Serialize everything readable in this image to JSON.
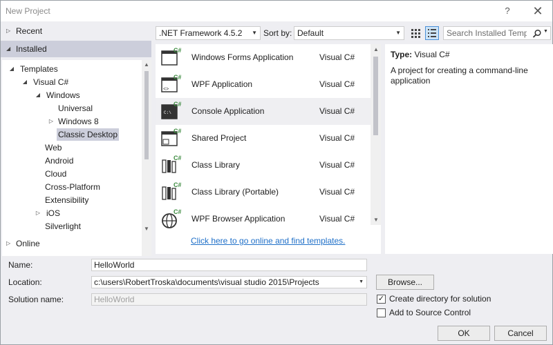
{
  "window": {
    "title": "New Project",
    "help_glyph": "?",
    "close_glyph": "✕"
  },
  "nav": {
    "recent": "Recent",
    "installed": "Installed",
    "online": "Online",
    "tree": [
      {
        "label": "Templates"
      },
      {
        "label": "Visual C#"
      },
      {
        "label": "Windows"
      },
      {
        "label": "Universal"
      },
      {
        "label": "Windows 8"
      },
      {
        "label": "Classic Desktop"
      },
      {
        "label": "Web"
      },
      {
        "label": "Android"
      },
      {
        "label": "Cloud"
      },
      {
        "label": "Cross-Platform"
      },
      {
        "label": "Extensibility"
      },
      {
        "label": "iOS"
      },
      {
        "label": "Silverlight"
      }
    ]
  },
  "toolbar": {
    "framework": ".NET Framework 4.5.2",
    "sort_by_label": "Sort by:",
    "sort_by_value": "Default",
    "search_placeholder": "Search Installed Templ"
  },
  "templates": [
    {
      "name": "Windows Forms Application",
      "lang": "Visual C#",
      "icon": "winforms-icon"
    },
    {
      "name": "WPF Application",
      "lang": "Visual C#",
      "icon": "wpf-icon"
    },
    {
      "name": "Console Application",
      "lang": "Visual C#",
      "icon": "console-icon"
    },
    {
      "name": "Shared Project",
      "lang": "Visual C#",
      "icon": "shared-project-icon"
    },
    {
      "name": "Class Library",
      "lang": "Visual C#",
      "icon": "class-library-icon"
    },
    {
      "name": "Class Library (Portable)",
      "lang": "Visual C#",
      "icon": "portable-library-icon"
    },
    {
      "name": "WPF Browser Application",
      "lang": "Visual C#",
      "icon": "wpf-browser-icon"
    }
  ],
  "online_link": "Click here to go online and find templates.",
  "description": {
    "type_label": "Type:",
    "type_value": "Visual C#",
    "text": "A project for creating a command-line application"
  },
  "form": {
    "name_label": "Name:",
    "name_value": "HelloWorld",
    "location_label": "Location:",
    "location_value": "c:\\users\\RobertTroska\\documents\\visual studio 2015\\Projects",
    "solution_label": "Solution name:",
    "solution_value": "HelloWorld",
    "browse": "Browse...",
    "create_dir_label": "Create directory for solution",
    "create_dir_checked": true,
    "source_control_label": "Add to Source Control",
    "source_control_checked": false,
    "ok": "OK",
    "cancel": "Cancel"
  },
  "colors": {
    "link": "#1e6fc8",
    "selection": "#cccedb",
    "background": "#eeeef2",
    "csharp_badge": "#3b8a3e"
  }
}
